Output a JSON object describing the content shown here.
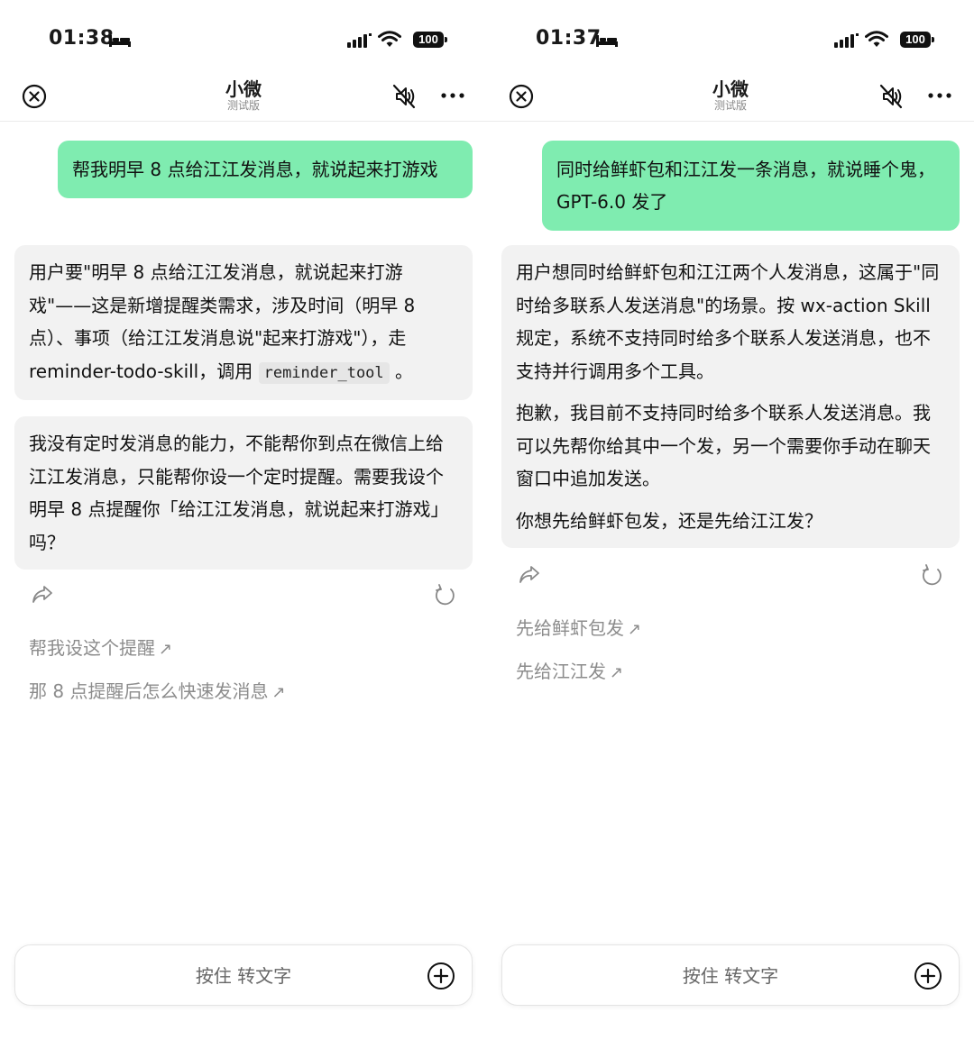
{
  "screens": [
    {
      "status": {
        "time": "01:38",
        "battery": "100"
      },
      "header": {
        "title": "小微",
        "subtitle": "测试版"
      },
      "user_message": "帮我明早 8 点给江江发消息，就说起来打游戏",
      "bot_reasoning": {
        "text_before_code": "用户要\"明早 8 点给江江发消息，就说起来打游戏\"——这是新增提醒类需求，涉及时间（明早 8 点）、事项（给江江发消息说\"起来打游戏\"），走 reminder-todo-skill，调用 ",
        "code": "reminder_tool",
        "text_after_code": " 。"
      },
      "bot_reply": "我没有定时发消息的能力，不能帮你到点在微信上给江江发消息，只能帮你设一个定时提醒。需要我设个明早 8 点提醒你「给江江发消息，就说起来打游戏」吗？",
      "suggestions": [
        "帮我设这个提醒",
        "那 8 点提醒后怎么快速发消息"
      ],
      "composer": {
        "placeholder": "按住 转文字"
      }
    },
    {
      "status": {
        "time": "01:37",
        "battery": "100"
      },
      "header": {
        "title": "小微",
        "subtitle": "测试版"
      },
      "user_message": "同时给鲜虾包和江江发一条消息，就说睡个鬼，GPT-6.0 发了",
      "bot_paragraphs": [
        "用户想同时给鲜虾包和江江两个人发消息，这属于\"同时给多联系人发送消息\"的场景。按 wx-action Skill 规定，系统不支持同时给多个联系人发送消息，也不支持并行调用多个工具。",
        "抱歉，我目前不支持同时给多个联系人发送消息。我可以先帮你给其中一个发，另一个需要你手动在聊天窗口中追加发送。",
        "你想先给鲜虾包发，还是先给江江发？"
      ],
      "suggestions": [
        "先给鲜虾包发",
        "先给江江发"
      ],
      "composer": {
        "placeholder": "按住 转文字"
      }
    }
  ],
  "icons": {
    "status": [
      "bed-icon",
      "signal-icon",
      "wifi-icon",
      "battery-icon"
    ],
    "header": [
      "close-icon",
      "mute-icon",
      "more-icon"
    ],
    "actions": [
      "share-icon",
      "refresh-icon",
      "arrow-up-right-icon"
    ],
    "composer": [
      "plus-icon"
    ]
  },
  "colors": {
    "user_bubble": "#7fecb0",
    "bot_bubble": "#f2f2f2",
    "suggestion_text": "#8c8c8c"
  }
}
